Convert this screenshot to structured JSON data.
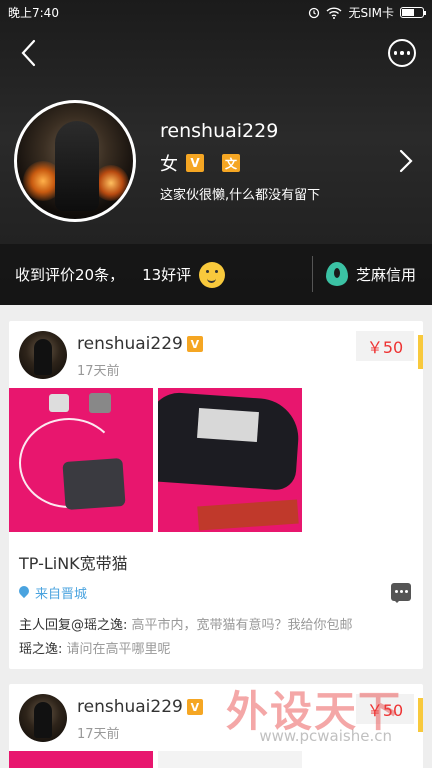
{
  "status_bar": {
    "time": "晚上7:40",
    "carrier": "无SIM卡"
  },
  "profile": {
    "username": "renshuai229",
    "gender": "女",
    "badge_v": "V",
    "badge_c": "文",
    "bio": "这家伙很懒,什么都没有留下"
  },
  "stats": {
    "reviews": "收到评价20条，",
    "good": "13好评",
    "sesame_label": "芝麻信用"
  },
  "accent_colors": {
    "yellow": "#f8c93c",
    "price_red": "#e33333",
    "link_blue": "#4aa3df",
    "sesame_green": "#3bc2a4"
  },
  "posts": [
    {
      "username": "renshuai229",
      "time": "17天前",
      "price": "￥50",
      "title": "TP-LiNK宽带猫",
      "location": "来自晋城",
      "replies": [
        {
          "name": "主人回复@瑶之逸:",
          "text": " 高平市内，宽带猫有意吗？我给你包邮"
        },
        {
          "name": "瑶之逸:",
          "text": " 请问在高平哪里呢"
        }
      ]
    },
    {
      "username": "renshuai229",
      "time": "17天前",
      "price": "￥50"
    }
  ],
  "watermark": {
    "text": "外设天下",
    "url": "www.pcwaishe.cn"
  }
}
